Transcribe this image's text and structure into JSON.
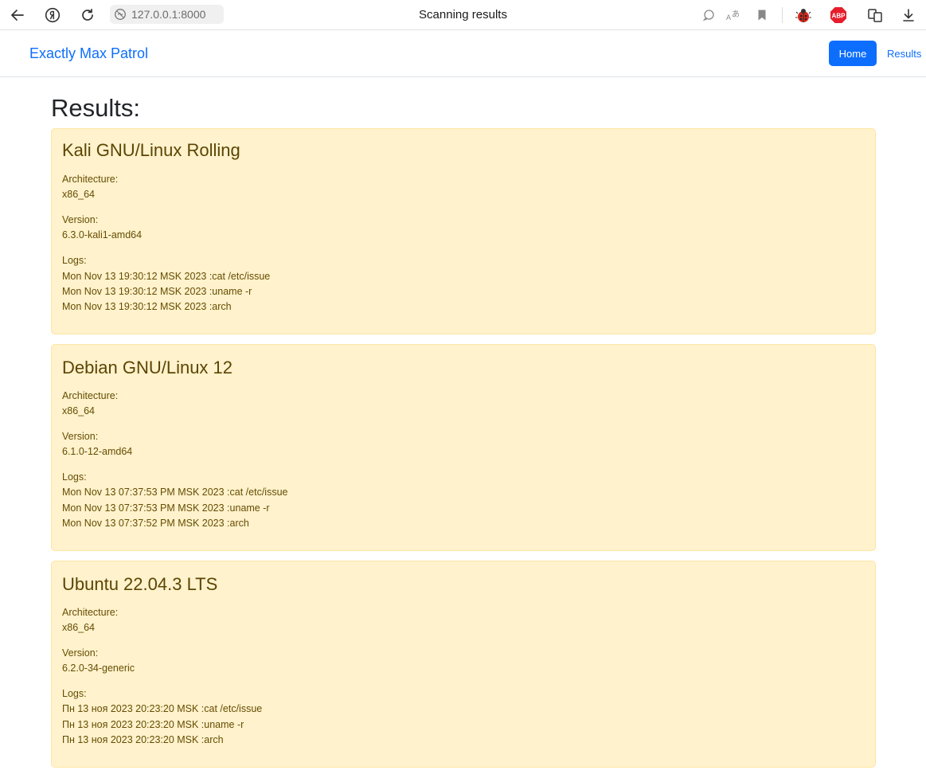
{
  "browser": {
    "url": "127.0.0.1:8000",
    "tab_title": "Scanning results",
    "icons": [
      "back-icon",
      "yandex-icon",
      "reload-icon",
      "site-info-icon",
      "chat-icon",
      "translate-icon",
      "bookmark-icon",
      "ladybug-extension-icon",
      "adblock-plus-icon",
      "extensions-icon",
      "download-icon"
    ],
    "abp_label": "ABP"
  },
  "navbar": {
    "brand": "Exactly Max Patrol",
    "home_label": "Home",
    "results_label": "Results"
  },
  "page": {
    "heading": "Results:"
  },
  "labels": {
    "architecture": "Architecture:",
    "version": "Version:",
    "logs": "Logs:"
  },
  "colors": {
    "accent": "#0d6efd",
    "card_bg": "#fff2cc",
    "card_text": "#664d03"
  },
  "results": [
    {
      "os": "Kali GNU/Linux Rolling",
      "architecture": "x86_64",
      "version": "6.3.0-kali1-amd64",
      "logs": [
        "Mon Nov 13 19:30:12 MSK 2023 :cat /etc/issue",
        "Mon Nov 13 19:30:12 MSK 2023 :uname -r",
        "Mon Nov 13 19:30:12 MSK 2023 :arch"
      ]
    },
    {
      "os": "Debian GNU/Linux 12",
      "architecture": "x86_64",
      "version": "6.1.0-12-amd64",
      "logs": [
        "Mon Nov 13 07:37:53 PM MSK 2023 :cat /etc/issue",
        "Mon Nov 13 07:37:53 PM MSK 2023 :uname -r",
        "Mon Nov 13 07:37:52 PM MSK 2023 :arch"
      ]
    },
    {
      "os": "Ubuntu 22.04.3 LTS",
      "architecture": "x86_64",
      "version": "6.2.0-34-generic",
      "logs": [
        "Пн 13 ноя 2023 20:23:20 MSK :cat /etc/issue",
        "Пн 13 ноя 2023 20:23:20 MSK :uname -r",
        "Пн 13 ноя 2023 20:23:20 MSK :arch"
      ]
    }
  ]
}
